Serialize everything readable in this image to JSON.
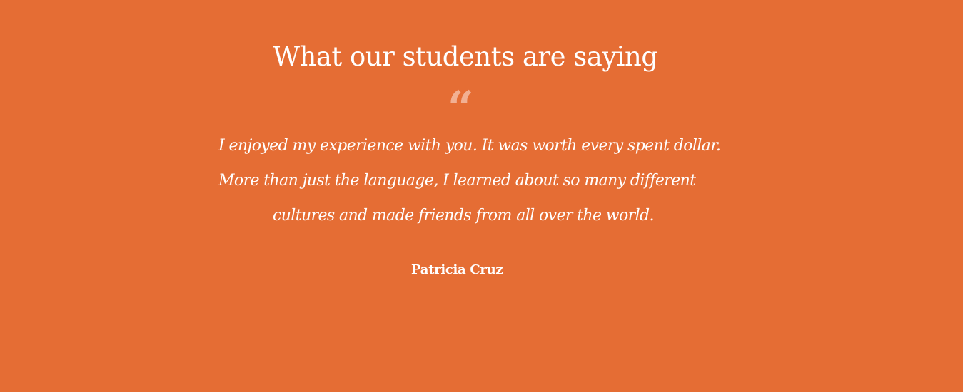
{
  "testimonial_section": {
    "title": "What our students are saying",
    "quote_icon": "quote-icon",
    "quote_lines": [
      "I enjoyed my experience with you. It was worth every spent dollar.",
      "More than just the language, I learned about so many different",
      "cultures and made friends from all over the world."
    ],
    "author": "Patricia Cruz"
  },
  "colors": {
    "background": "#e56d34",
    "text": "#ffffff",
    "quote_icon": "#f2b092"
  }
}
